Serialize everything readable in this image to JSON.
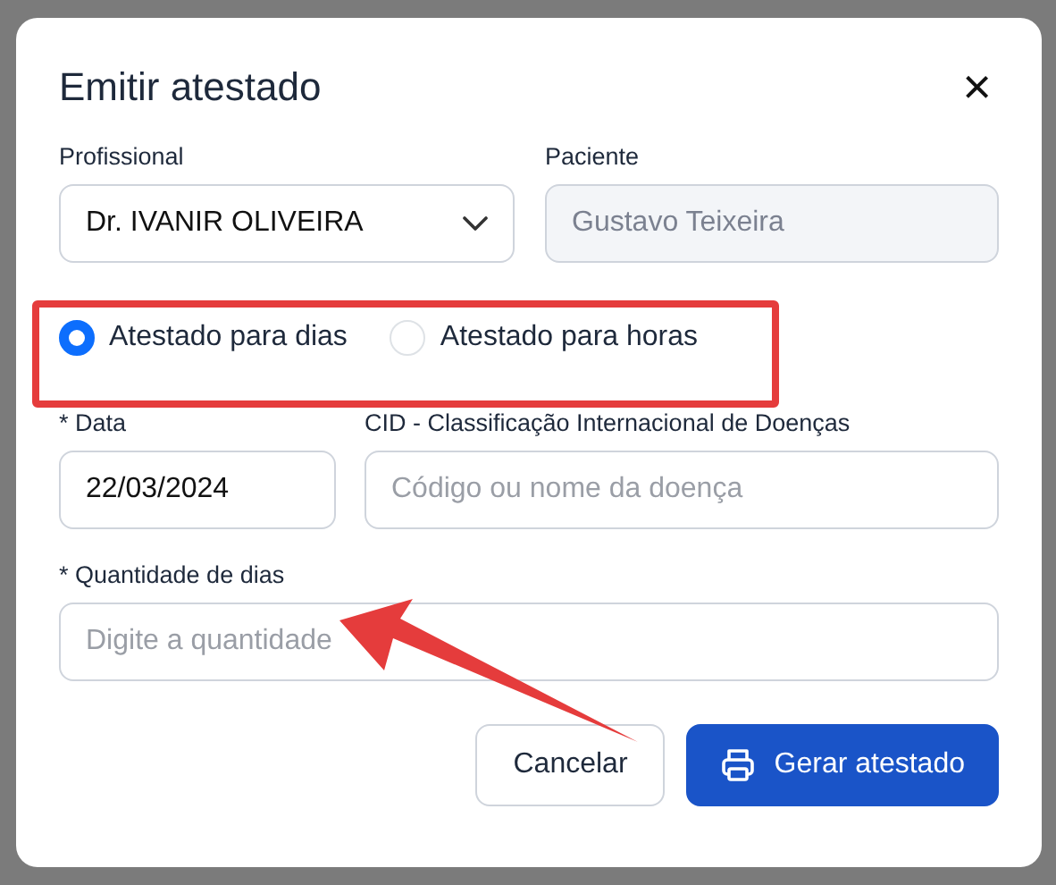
{
  "dialog": {
    "title": "Emitir atestado",
    "close": "×"
  },
  "fields_top": [
    {
      "label": "Profissional",
      "kind": "select",
      "value": "Dr. IVANIR OLIVEIRA",
      "disabled": false
    },
    {
      "label": "Paciente",
      "kind": "text",
      "value": "Gustavo Teixeira",
      "disabled": true
    }
  ],
  "type_options": [
    {
      "label": "Atestado para dias",
      "selected": true
    },
    {
      "label": "Atestado para horas",
      "selected": false
    }
  ],
  "fields_mid": [
    {
      "label": "* Data",
      "value": "22/03/2024"
    },
    {
      "label": "CID - Classificação Internacional de Doenças",
      "placeholder": "Código ou nome da doença"
    }
  ],
  "quantity": {
    "label": "* Quantidade de dias",
    "placeholder": "Digite a quantidade"
  },
  "buttons": [
    {
      "label": "Cancelar",
      "kind": "secondary"
    },
    {
      "label": "Gerar atestado",
      "kind": "primary"
    }
  ]
}
